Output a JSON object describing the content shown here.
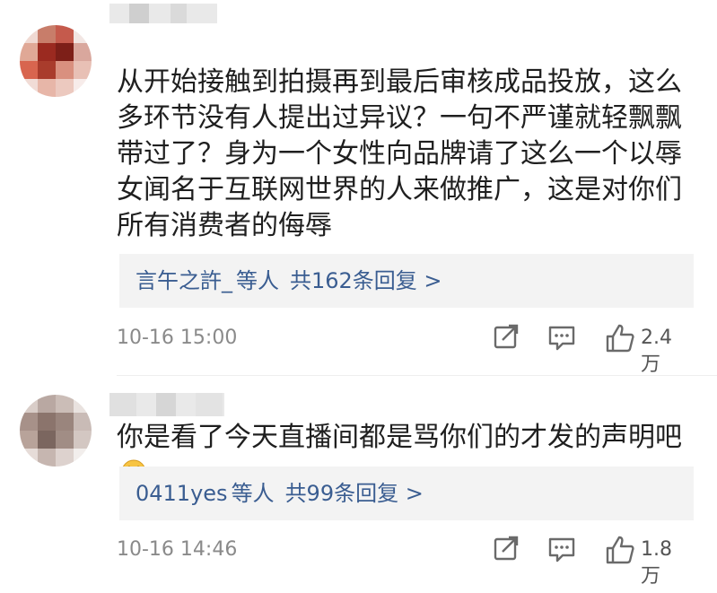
{
  "comments": [
    {
      "text": "从开始接触到拍摄再到最后审核成品投放，这么多环节没有人提出过异议？一句不严谨就轻飘飘带过了？身为一个女性向品牌请了这么一个以辱女闻名于互联网世界的人来做推广，这是对你们所有消费者的侮辱",
      "replies_user": "言午之許_",
      "replies_label": "等人",
      "replies_count_text": "共162条回复 >",
      "timestamp": "10-16 15:00",
      "likes": "2.4万"
    },
    {
      "text": "你是看了今天直播间都是骂你们的才发的声明吧",
      "replies_user": "0411yes",
      "replies_label": "等人",
      "replies_count_text": "共99条回复 >",
      "timestamp": "10-16 14:46",
      "likes": "1.8万"
    }
  ],
  "icons": {
    "share": "share-icon",
    "comment": "comment-icon",
    "like": "thumbs-up-icon",
    "emoji": "laughing-crying-emoji"
  },
  "colors": {
    "link": "#3a5d91",
    "meta": "#8a8a8a",
    "reply_bg": "#f3f3f3"
  }
}
